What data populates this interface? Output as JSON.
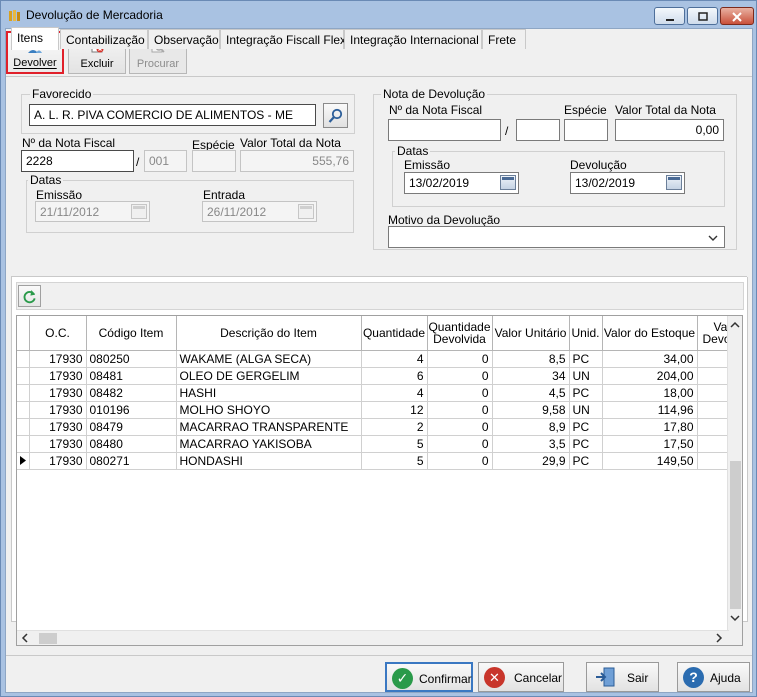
{
  "window": {
    "title": "Devolução de Mercadoria"
  },
  "toolbar": {
    "devolver": "Devolver",
    "excluir": "Excluir",
    "procurar": "Procurar"
  },
  "form": {
    "favorecido_label": "Favorecido",
    "favorecido_value": "A. L. R. PIVA COMERCIO DE ALIMENTOS - ME",
    "nota_fiscal_label": "Nº da Nota Fiscal",
    "nota_fiscal_value": "2228",
    "serie_value": "001",
    "especie_label": "Espécie",
    "especie_value": "",
    "valor_total_label": "Valor Total da Nota",
    "valor_total_value": "555,76",
    "datas_label": "Datas",
    "emissao_label": "Emissão",
    "emissao_value": "21/11/2012",
    "entrada_label": "Entrada",
    "entrada_value": "26/11/2012"
  },
  "devolucao": {
    "group_label": "Nota de Devolução",
    "nota_fiscal_label": "Nº da Nota Fiscal",
    "nota_fiscal_value": "",
    "serie_value": "",
    "especie_label": "Espécie",
    "especie_value": "",
    "valor_total_label": "Valor Total da Nota",
    "valor_total_value": "0,00",
    "datas_label": "Datas",
    "emissao_label": "Emissão",
    "emissao_value": "13/02/2019",
    "devolucao_label": "Devolução",
    "devolucao_value": "13/02/2019",
    "motivo_label": "Motivo da Devolução",
    "motivo_value": ""
  },
  "tabs": [
    "Itens",
    "Contabilização",
    "Observação",
    "Integração Fiscall Flex",
    "Integração Internacional",
    "Frete"
  ],
  "grid": {
    "headers": [
      "O.C.",
      "Código Item",
      "Descrição do Item",
      "Quantidade",
      "Quantidade Devolvida",
      "Valor Unitário",
      "Unid.",
      "Valor do Estoque",
      "Valor Devolvido"
    ],
    "header_cut": [
      "Va",
      "Devo"
    ],
    "rows": [
      [
        "17930",
        "080250",
        "WAKAME (ALGA SECA)",
        "4",
        "0",
        "8,5",
        "PC",
        "34,00"
      ],
      [
        "17930",
        "08481",
        "OLEO DE GERGELIM",
        "6",
        "0",
        "34",
        "UN",
        "204,00"
      ],
      [
        "17930",
        "08482",
        "HASHI",
        "4",
        "0",
        "4,5",
        "PC",
        "18,00"
      ],
      [
        "17930",
        "010196",
        "MOLHO SHOYO",
        "12",
        "0",
        "9,58",
        "UN",
        "114,96"
      ],
      [
        "17930",
        "08479",
        "MACARRAO TRANSPARENTE",
        "2",
        "0",
        "8,9",
        "PC",
        "17,80"
      ],
      [
        "17930",
        "08480",
        "MACARRAO YAKISOBA",
        "5",
        "0",
        "3,5",
        "PC",
        "17,50"
      ],
      [
        "17930",
        "080271",
        "HONDASHI",
        "5",
        "0",
        "29,9",
        "PC",
        "149,50"
      ]
    ]
  },
  "buttons": {
    "confirmar": "Confirmar",
    "cancelar": "Cancelar",
    "sair": "Sair",
    "ajuda": "Ajuda"
  },
  "colors": {
    "accent": "#2a8a3a",
    "cancel": "#c0392b",
    "help": "#2b6cb0",
    "highlight": "#e0202a"
  }
}
